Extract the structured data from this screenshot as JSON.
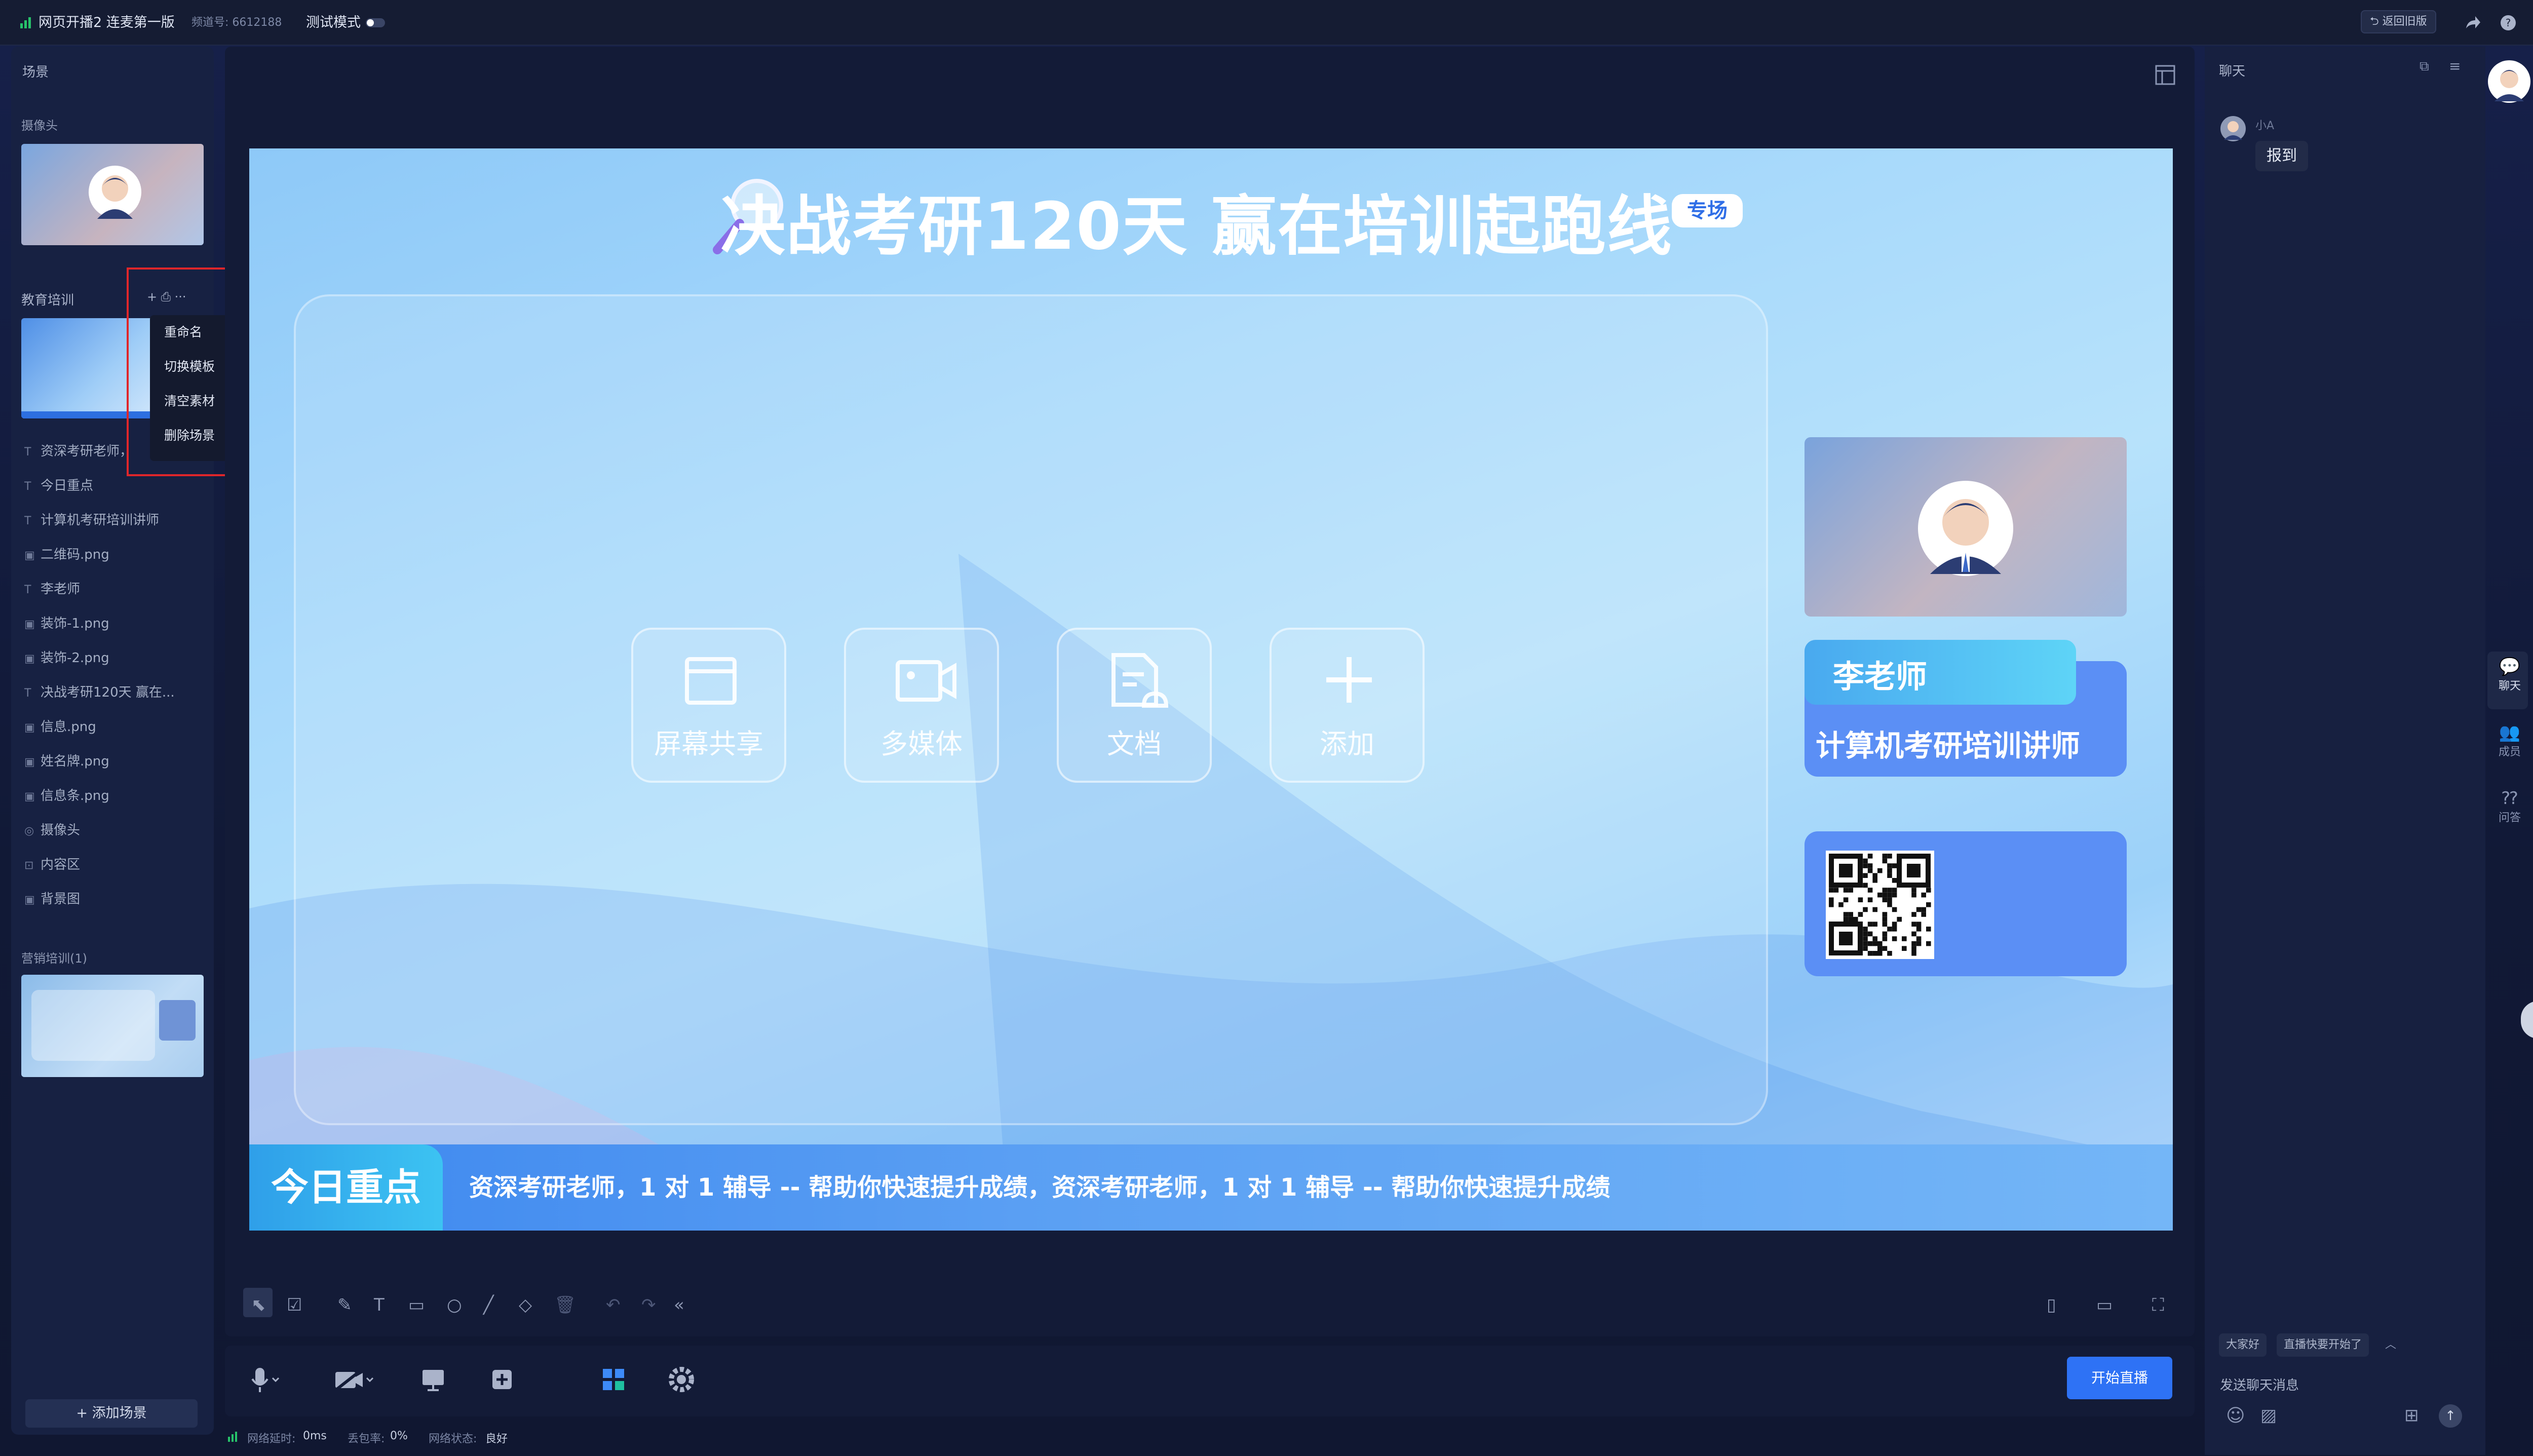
{
  "topbar": {
    "title": "网页开播2 连麦第一版",
    "channel": "频道号: 6612188",
    "test_mode": "测试模式",
    "back_old": "返回旧版"
  },
  "left": {
    "header": "场景",
    "camera_label": "摄像头",
    "scene_edu": "教育培训",
    "scene_edu_ctrl": "+ ⎙ ···",
    "context_menu": [
      "重命名",
      "切换模板",
      "清空素材",
      "删除场景"
    ],
    "layers": [
      {
        "icon": "T",
        "label": "资深考研老师，"
      },
      {
        "icon": "T",
        "label": "今日重点"
      },
      {
        "icon": "T",
        "label": "计算机考研培训讲师"
      },
      {
        "icon": "▣",
        "label": "二维码.png"
      },
      {
        "icon": "T",
        "label": "李老师"
      },
      {
        "icon": "▣",
        "label": "装饰-1.png"
      },
      {
        "icon": "▣",
        "label": "装饰-2.png"
      },
      {
        "icon": "T",
        "label": "决战考研120天 赢在..."
      },
      {
        "icon": "▣",
        "label": "信息.png"
      },
      {
        "icon": "▣",
        "label": "姓名牌.png"
      },
      {
        "icon": "▣",
        "label": "信息条.png"
      },
      {
        "icon": "◎",
        "label": "摄像头"
      },
      {
        "icon": "⊡",
        "label": "内容区"
      },
      {
        "icon": "▣",
        "label": "背景图"
      }
    ],
    "scene_marketing": "营销培训(1)",
    "add_scene": "+ 添加场景"
  },
  "canvas": {
    "title": "决战考研120天 赢在培训起跑线",
    "badge": "专场",
    "tiles": [
      "屏幕共享",
      "多媒体",
      "文档",
      "添加"
    ],
    "teacher_name": "李老师",
    "teacher_role": "计算机考研培训讲师",
    "today_tag": "今日重点",
    "ticker": "资深考研老师，1 对 1 辅导 -- 帮助你快速提升成绩，资深考研老师，1 对 1 辅导 -- 帮助你快速提升成绩"
  },
  "controls": {
    "go_live": "开始直播"
  },
  "status": {
    "latency_label": "网络延时:",
    "latency": "0ms",
    "loss_label": "丢包率:",
    "loss": "0%",
    "state_label": "网络状态:",
    "state": "良好"
  },
  "chat": {
    "header": "聊天",
    "message_user": "小A",
    "message_text": "报到",
    "quick_replies": [
      "大家好",
      "直播快要开始了"
    ],
    "input_placeholder": "发送聊天消息"
  },
  "rail": {
    "chat": "聊天",
    "members": "成员",
    "qa": "问答"
  },
  "colors": {
    "accent": "#2e72f5",
    "highlight": "#e0262a",
    "card": "#5b8ff5"
  }
}
